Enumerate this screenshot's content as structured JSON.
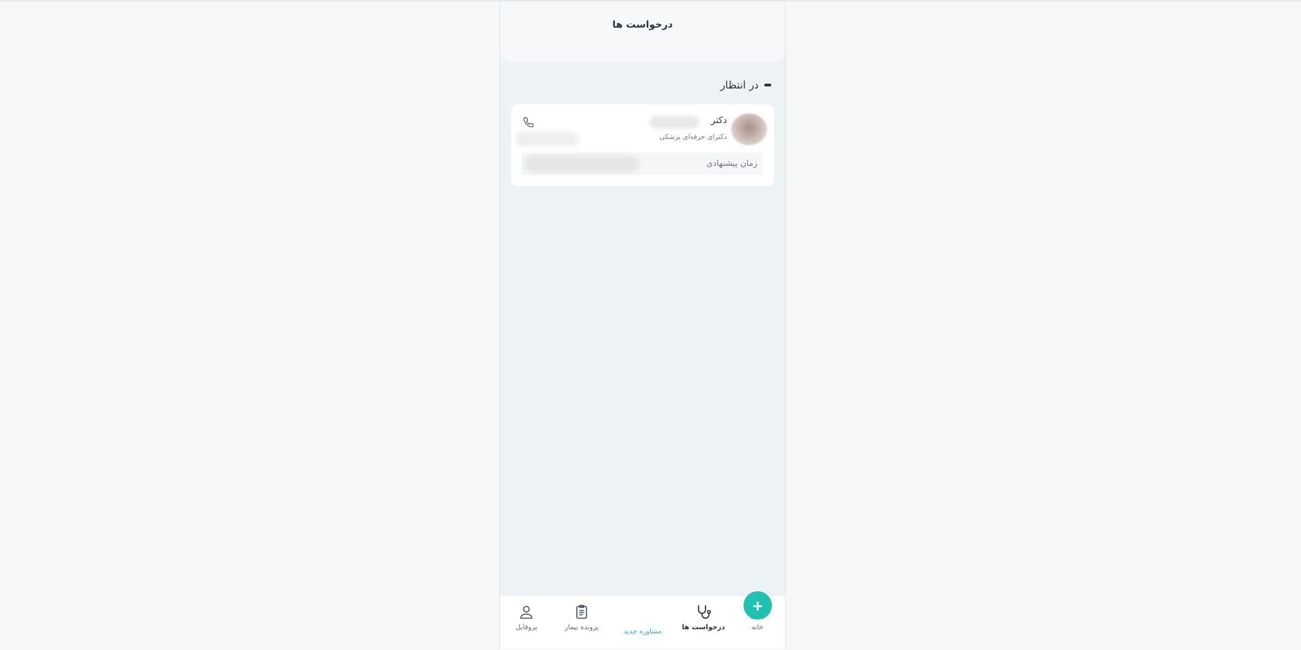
{
  "header": {
    "title": "درخواست ها"
  },
  "section": {
    "title": "در انتظار"
  },
  "request_card": {
    "doctor_prefix": "دکتر",
    "degree": "دکترای حرفه‌ای پزشکی",
    "suggested_time_label": "زمان پیشنهادی"
  },
  "bottom_nav": {
    "items": [
      {
        "label": "خانه",
        "icon": "home-icon"
      },
      {
        "label": "درخواست ها",
        "icon": "stethoscope-icon"
      },
      {
        "label": "مشاوره جدید",
        "icon": "plus-icon"
      },
      {
        "label": "پرونده بیمار",
        "icon": "clipboard-icon"
      },
      {
        "label": "پروفایل",
        "icon": "user-icon"
      }
    ],
    "active_index": 1
  },
  "colors": {
    "accent": "#1fc1b0",
    "page_background": "#f5f7f9",
    "app_background": "#edf2f5",
    "text": "#2b3440"
  }
}
